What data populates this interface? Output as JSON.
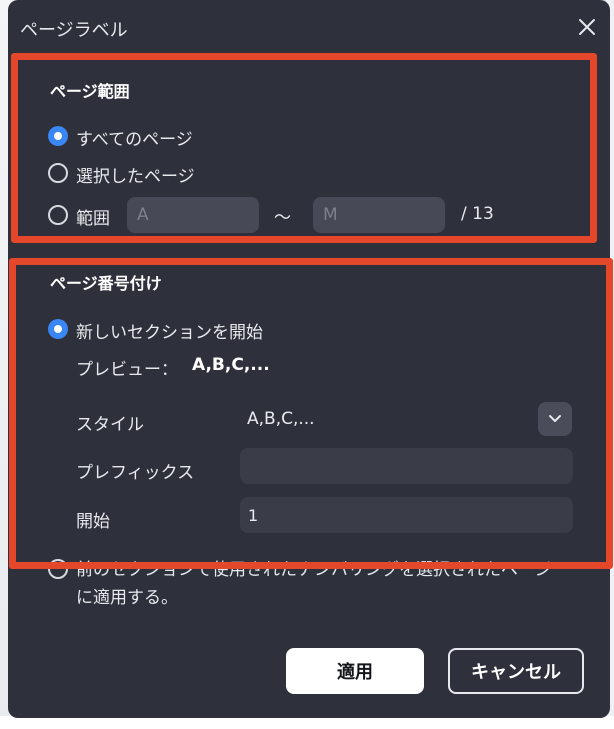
{
  "dialog": {
    "title": "ページラベル"
  },
  "page_range": {
    "title": "ページ範囲",
    "options": [
      {
        "label": "すべてのページ",
        "checked": true
      },
      {
        "label": "選択したページ",
        "checked": false
      },
      {
        "label": "範囲",
        "checked": false
      }
    ],
    "range_from_placeholder": "A",
    "range_tilde": "～",
    "range_to_placeholder": "M",
    "total": "/ 13"
  },
  "numbering": {
    "title": "ページ番号付け",
    "new_section_label": "新しいセクションを開始",
    "preview_label": "プレビュー：",
    "preview_value": "A,B,C,...",
    "style_label": "スタイル",
    "style_value": "A,B,C,...",
    "prefix_label": "プレフィックス",
    "prefix_value": "",
    "start_label": "開始",
    "start_value": "1",
    "extend_label": "前のセクションで使用されたナンバリングを選択されたページに適用する。"
  },
  "buttons": {
    "apply": "適用",
    "cancel": "キャンセル"
  },
  "colors": {
    "dialog_bg": "#2e303b",
    "accent": "#3a86f4",
    "highlight": "#e5472a"
  }
}
